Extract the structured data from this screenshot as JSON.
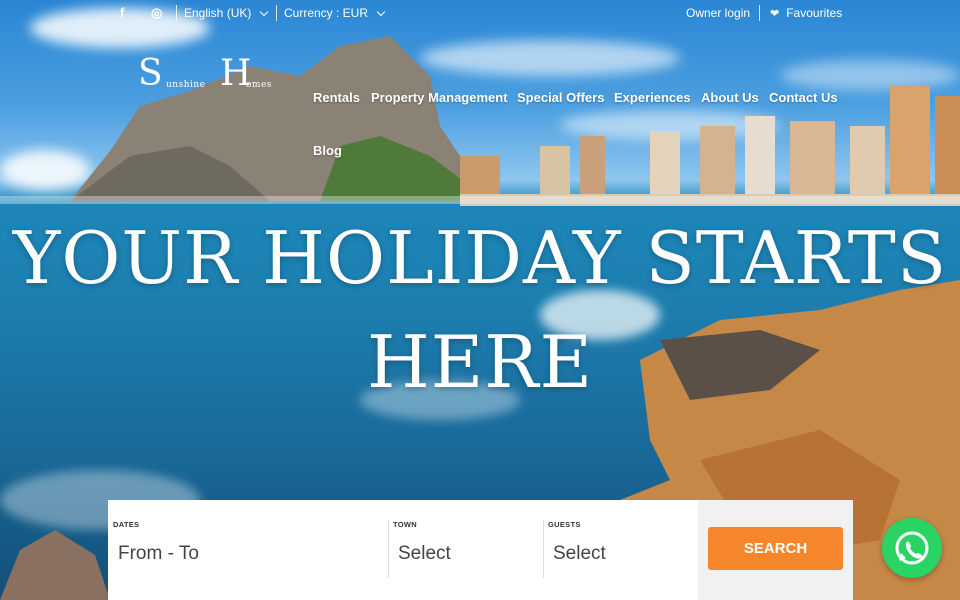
{
  "topbar": {
    "social": [
      {
        "icon": "facebook-icon",
        "glyph": "f"
      },
      {
        "icon": "instagram-icon",
        "glyph": "◎"
      }
    ],
    "language": "English (UK)",
    "currency": "Currency : EUR",
    "owner_login": "Owner login",
    "favourites": "Favourites",
    "favourites_icon": "heart-icon"
  },
  "logo": {
    "letter1": "S",
    "text1": "unshine",
    "letter2": "H",
    "text2": "omes"
  },
  "nav": {
    "items": [
      "Rentals",
      "Property Management",
      "Special Offers",
      "Experiences",
      "About Us",
      "Contact Us",
      "Blog"
    ]
  },
  "hero": {
    "line1": "YOUR HOLIDAY STARTS",
    "line2": "HERE"
  },
  "search": {
    "dates_label": "DATES",
    "dates_value": "From - To",
    "town_label": "TOWN",
    "town_value": "Select",
    "guests_label": "GUESTS",
    "guests_value": "Select",
    "button": "SEARCH"
  },
  "colors": {
    "accent": "#f5862b",
    "whatsapp": "#29d465"
  },
  "whatsapp": {
    "icon": "whatsapp-icon"
  }
}
